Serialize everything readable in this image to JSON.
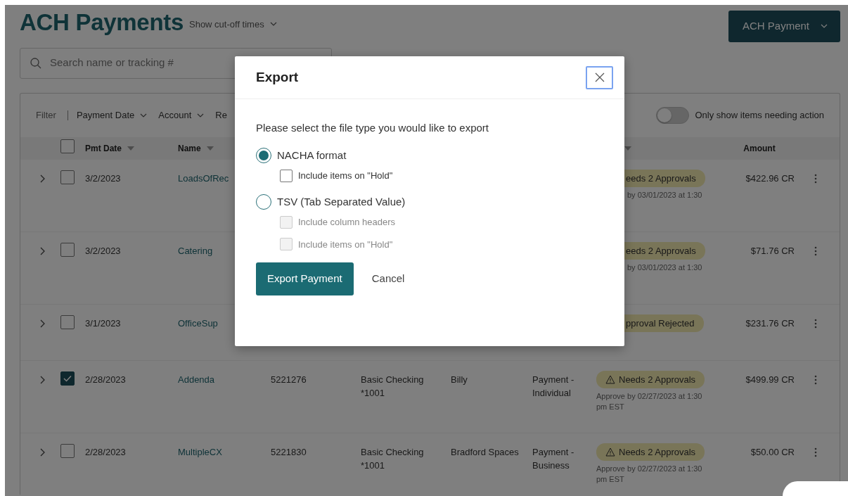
{
  "header": {
    "title": "ACH Payments",
    "cutoff_link": "Show cut-off times",
    "new_button": "ACH Payment"
  },
  "search": {
    "placeholder": "Search name or tracking #"
  },
  "filters": {
    "label": "Filter",
    "items": [
      {
        "label": "Payment Date",
        "caret": true
      },
      {
        "label": "Account",
        "caret": true
      },
      {
        "label": "Re",
        "caret": false
      }
    ]
  },
  "toggle": {
    "label": "Only show items needing action",
    "on": false
  },
  "table": {
    "select_all": {
      "checked": false
    },
    "columns": {
      "pmt_date": {
        "label": "Pmt Date",
        "sortable": true
      },
      "name": {
        "label": "Name",
        "sortable": true
      },
      "column_9": {
        "sortable": true
      },
      "amount": {
        "label": "Amount",
        "sortable": false
      }
    },
    "rows": [
      {
        "expanded": false,
        "checked": false,
        "date": "3/2/2023",
        "name": "LoadsOfRec",
        "status": {
          "label": "eeds 2 Approvals",
          "kind": "plain",
          "note": "by 03/01/2023 at 1:30",
          "clipped": true
        },
        "amount": "$422.96 CR"
      },
      {
        "expanded": false,
        "checked": false,
        "date": "3/2/2023",
        "name": "Catering",
        "status": {
          "label": "eeds 2 Approvals",
          "kind": "plain",
          "note": "by 03/01/2023 at 1:30",
          "clipped": true
        },
        "amount": "$71.76 CR"
      },
      {
        "expanded": false,
        "checked": false,
        "date": "3/1/2023",
        "name": "OfficeSup",
        "status": {
          "label": "pproval Rejected",
          "kind": "plain",
          "clipped": true
        },
        "amount": "$231.76 CR"
      },
      {
        "expanded": false,
        "checked": true,
        "date": "2/28/2023",
        "name": "Addenda",
        "tracking": "5221276",
        "account": "Basic Checking *1001",
        "payee": "Billy",
        "type": "Payment - Individual",
        "status": {
          "label": "Needs 2 Approvals",
          "kind": "warning",
          "note": "Approve by 02/27/2023 at 1:30 pm EST",
          "clipped": false
        },
        "amount": "$499.99 CR"
      },
      {
        "expanded": false,
        "checked": false,
        "date": "2/28/2023",
        "name": "MultipleCX",
        "tracking": "5221830",
        "account": "Basic Checking *1001",
        "payee": "Bradford Spaces",
        "type": "Payment - Business",
        "status": {
          "label": "Needs 2 Approvals",
          "kind": "warning",
          "note": "Approve by 02/27/2023 at 1:30 pm EST",
          "clipped": false
        },
        "amount": "$50.00 CR"
      }
    ]
  },
  "dialog": {
    "title": "Export",
    "prompt": "Please select the file type you would like to export",
    "options": [
      {
        "label": "NACHA format",
        "selected": true,
        "checkboxes": [
          {
            "label": "Include items on \"Hold\"",
            "checked": false,
            "disabled": false
          }
        ]
      },
      {
        "label": "TSV (Tab Separated Value)",
        "selected": false,
        "checkboxes": [
          {
            "label": "Include column headers",
            "checked": false,
            "disabled": true
          },
          {
            "label": "Include items on \"Hold\"",
            "checked": false,
            "disabled": true
          }
        ]
      }
    ],
    "primary_button": "Export Payment",
    "cancel_button": "Cancel"
  }
}
